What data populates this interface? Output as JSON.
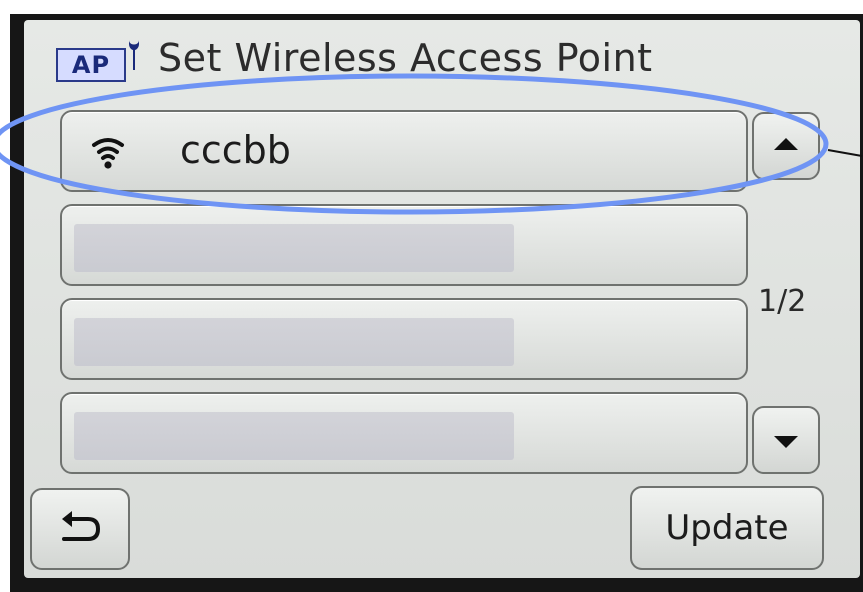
{
  "header": {
    "icon_label": "AP",
    "title": "Set Wireless Access Point"
  },
  "access_points": [
    {
      "ssid": "cccbb",
      "signal_icon": "wifi-signal-icon",
      "redacted": false
    },
    {
      "ssid": "",
      "redacted": true
    },
    {
      "ssid": "",
      "redacted": true
    },
    {
      "ssid": "",
      "redacted": true
    }
  ],
  "pagination": {
    "page_indicator": "1/2",
    "up_icon": "triangle-up-icon",
    "down_icon": "triangle-down-icon"
  },
  "footer": {
    "back_icon": "return-arrow-icon",
    "update_label": "Update"
  },
  "colors": {
    "highlight_ellipse": "#6f94f4",
    "icon_box_fill": "#d6dcff",
    "icon_box_border": "#2a3a8a"
  }
}
